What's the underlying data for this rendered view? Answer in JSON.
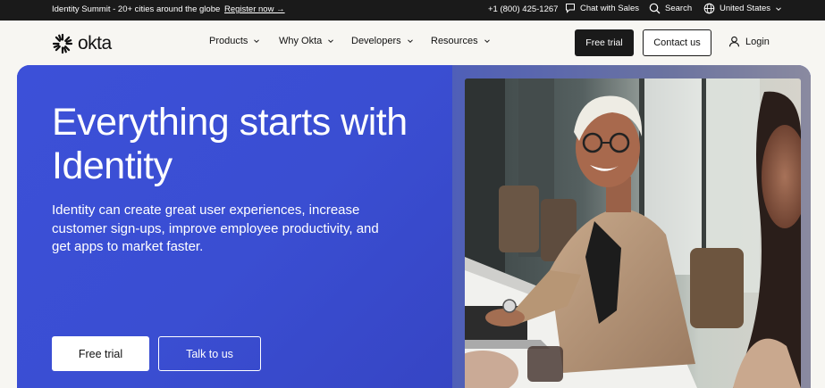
{
  "topbar": {
    "announcement": "Identity Summit - 20+ cities around the globe",
    "register_link": "Register now →",
    "phone": "+1 (800) 425-1267",
    "chat": "Chat with Sales",
    "search": "Search",
    "region": "United States"
  },
  "header": {
    "logo": "okta",
    "nav": [
      "Products",
      "Why Okta",
      "Developers",
      "Resources"
    ],
    "free_trial": "Free trial",
    "contact": "Contact us",
    "login": "Login"
  },
  "hero": {
    "title": "Everything starts with Identity",
    "subtitle": "Identity can create great user experiences, increase customer sign-ups, improve employee productivity, and get apps to market faster.",
    "primary_cta": "Free trial",
    "secondary_cta": "Talk to us",
    "colors": {
      "hero_blue": "#3c50d8",
      "dark": "#1a1a1a"
    }
  },
  "icons": [
    "chat-icon",
    "search-icon",
    "globe-icon",
    "chevron-down-icon",
    "user-icon",
    "okta-logo-icon"
  ]
}
